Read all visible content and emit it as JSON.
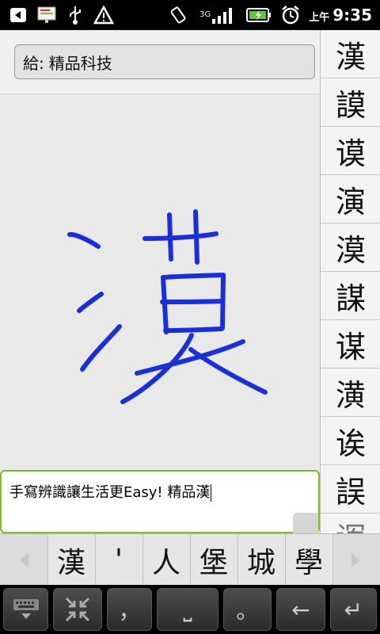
{
  "status_bar": {
    "icons": [
      "back-icon",
      "screen-icon",
      "usb-icon",
      "alert-icon",
      "rotate-icon",
      "signal-3g-icon",
      "battery-icon",
      "alarm-icon"
    ],
    "network_type": "3G",
    "ampm": "上午",
    "time": "9:35"
  },
  "compose": {
    "to_label": "給:",
    "to_value": "精品科技",
    "message_text": "手寫辨識讓生活更Easy!  精品漢"
  },
  "side_candidates": [
    "漢",
    "謨",
    "谟",
    "演",
    "漠",
    "謀",
    "谋",
    "潢",
    "诶",
    "誤",
    "诨"
  ],
  "strip_candidates": [
    "漢",
    "'",
    "人",
    "堡",
    "城",
    "學"
  ],
  "keyboard": {
    "comma_key": "，",
    "space_key": "⎵",
    "period_key": "。",
    "backspace_key": "←",
    "enter_key": "↵"
  },
  "colors": {
    "ink": "#1a2fd6",
    "accent": "#7dc022"
  }
}
